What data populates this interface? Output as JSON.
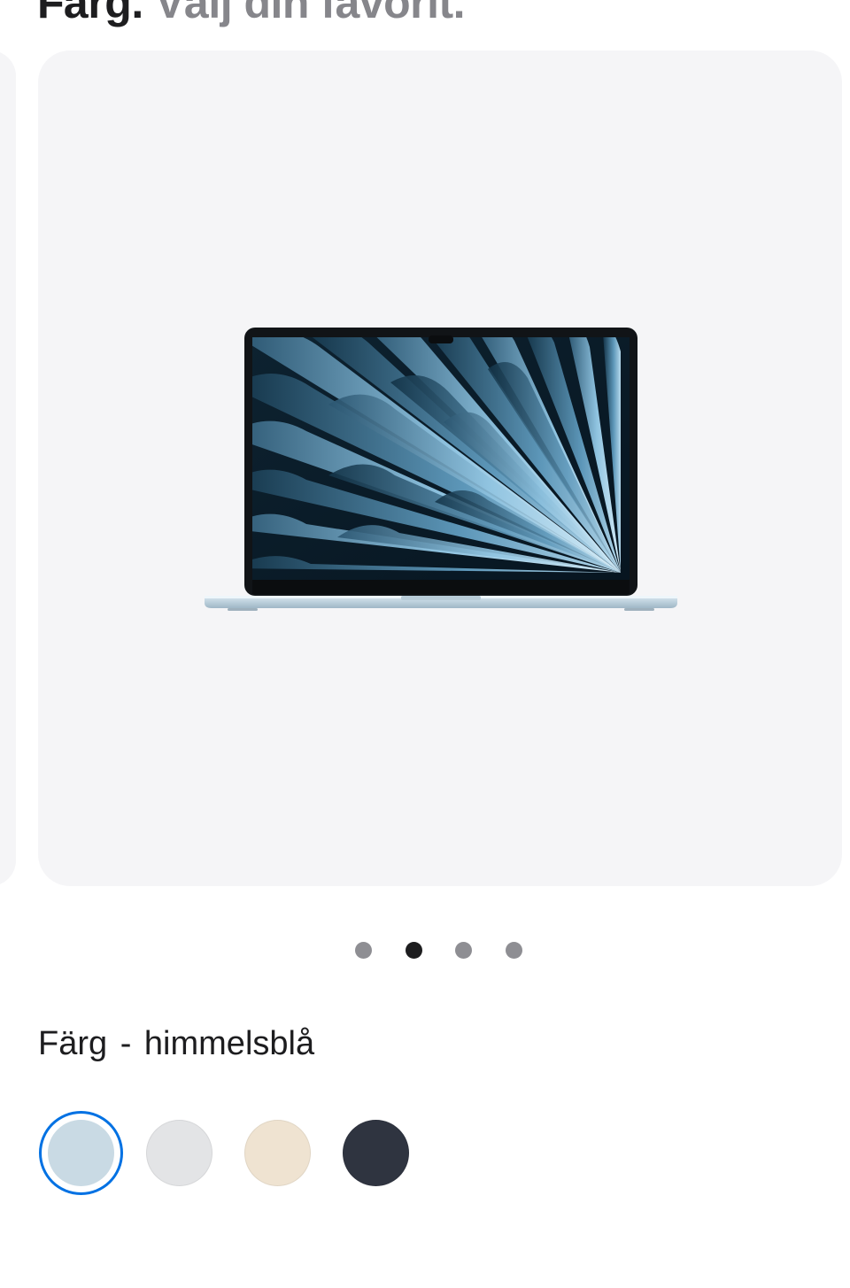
{
  "header": {
    "title_strong": "Färg.",
    "title_muted": "Välj din favorit."
  },
  "gallery": {
    "image_icon": "macbook-air-laptop-icon",
    "dots": [
      {
        "active": false
      },
      {
        "active": true
      },
      {
        "active": false
      },
      {
        "active": false
      }
    ]
  },
  "color_picker": {
    "label": "Färg",
    "separator": "-",
    "selected_name": "himmelsblå",
    "swatches": [
      {
        "color": "#c9dae4",
        "selected": true
      },
      {
        "color": "#e3e4e6",
        "selected": false
      },
      {
        "color": "#efe3d1",
        "selected": false
      },
      {
        "color": "#2f3440",
        "selected": false
      }
    ]
  }
}
